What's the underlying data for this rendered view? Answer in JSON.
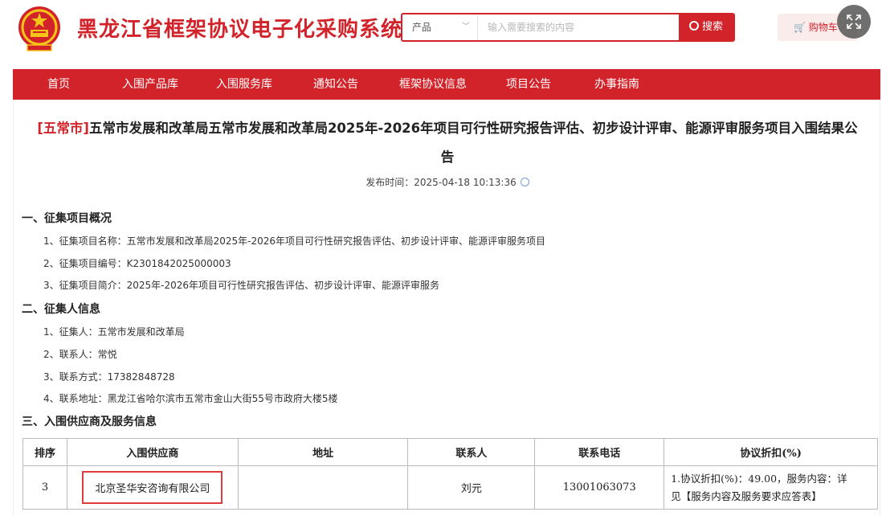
{
  "header": {
    "site_title": "黑龙江省框架协议电子化采购系统",
    "search_category": "产品",
    "search_placeholder": "输入需要搜索的内容",
    "search_button": "搜索",
    "cart_label": "购物车"
  },
  "nav": [
    "首页",
    "入围产品库",
    "入围服务库",
    "通知公告",
    "框架协议信息",
    "项目公告",
    "办事指南"
  ],
  "article": {
    "region_tag": "[五常市]",
    "title_line1": "五常市发展和改革局五常市发展和改革局2025年-2026年项目可行性研究报告评估、初步设计评审、能源评审服务项目入围结果公",
    "title_line2": "告",
    "publish_label": "发布时间：",
    "publish_time": "2025-04-18 10:13:36",
    "sections": [
      {
        "heading": "一、征集项目概况",
        "items": [
          "1、征集项目名称：五常市发展和改革局2025年-2026年项目可行性研究报告评估、初步设计评审、能源评审服务项目",
          "2、征集项目编号：K2301842025000003",
          "3、征集项目简介：2025年-2026年项目可行性研究报告评估、初步设计评审、能源评审服务"
        ]
      },
      {
        "heading": "二、征集人信息",
        "items": [
          "1、征集人：五常市发展和改革局",
          "2、联系人：常悦",
          "3、联系方式：17382848728",
          "4、联系地址：黑龙江省哈尔滨市五常市金山大街55号市政府大楼5楼"
        ]
      },
      {
        "heading": "三、入围供应商及服务信息",
        "items": []
      }
    ]
  },
  "table": {
    "headers": [
      "排序",
      "入围供应商",
      "地址",
      "联系人",
      "联系电话",
      "协议折扣(%)"
    ],
    "rows": [
      {
        "rank": "3",
        "supplier": "北京圣华安咨询有限公司",
        "address": "",
        "contact": "刘元",
        "phone": "13001063073",
        "discount_line1": "1.协议折扣(%)：49.00，服务内容：详",
        "discount_line2": "见【服务内容及服务要求应答表】"
      }
    ]
  },
  "colors": {
    "brand_red": "#d2232a",
    "highlight_box": "#e03c3c"
  },
  "icons": [
    "national-emblem-icon",
    "chevron-down-icon",
    "search-icon",
    "cart-icon",
    "expand-icon",
    "print-icon"
  ]
}
